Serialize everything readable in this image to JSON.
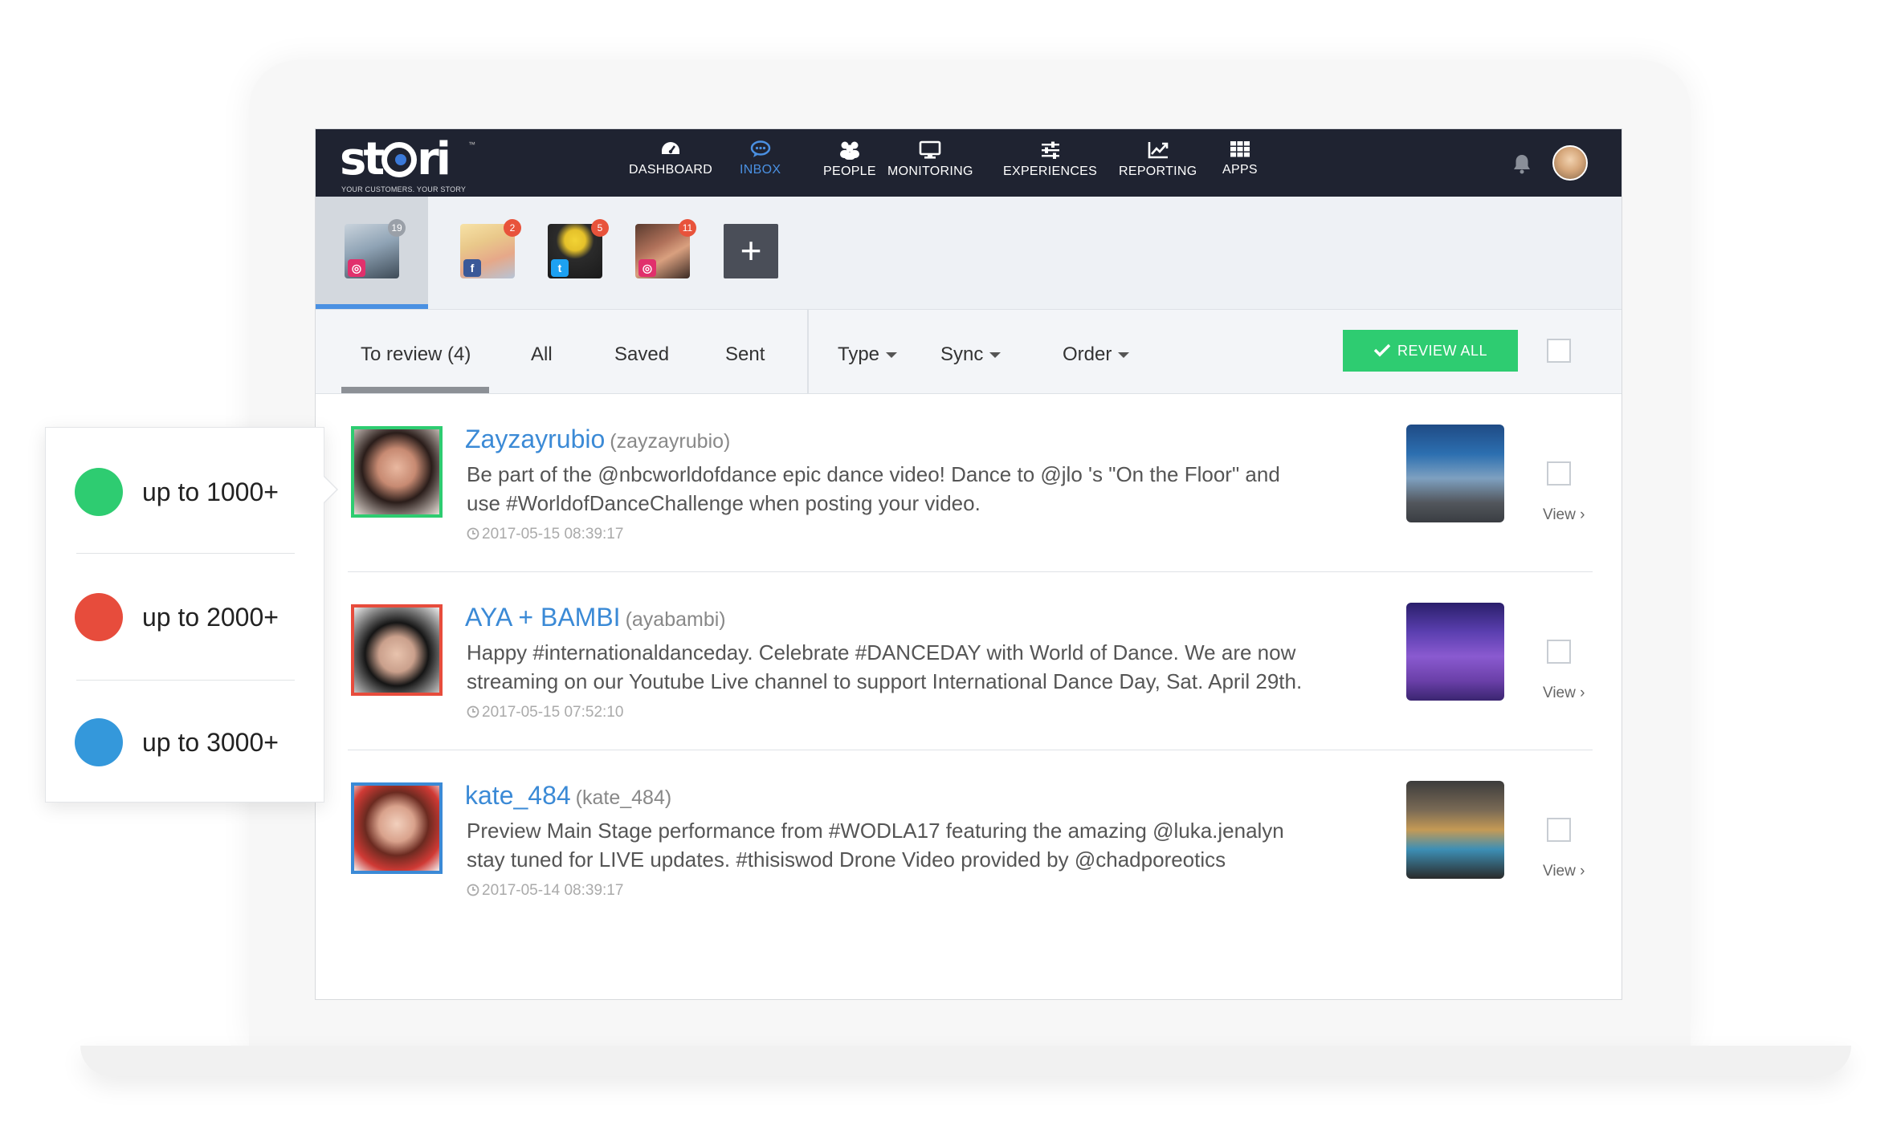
{
  "app": {
    "logo_text": "stori",
    "logo_tagline": "YOUR CUSTOMERS. YOUR STORY",
    "logo_tm": "™"
  },
  "nav": {
    "items": [
      {
        "label": "DASHBOARD",
        "icon": "dashboard-icon"
      },
      {
        "label": "INBOX",
        "icon": "chat-bubble-icon",
        "active": true
      },
      {
        "label": "PEOPLE",
        "icon": "people-icon"
      },
      {
        "label": "MONITORING",
        "icon": "monitor-icon"
      },
      {
        "label": "EXPERIENCES",
        "icon": "sliders-icon"
      },
      {
        "label": "REPORTING",
        "icon": "chart-line-icon"
      },
      {
        "label": "APPS",
        "icon": "grid-icon"
      }
    ],
    "accent_color": "#4a90e2"
  },
  "accounts": [
    {
      "network": "instagram",
      "network_glyph": "◎",
      "badge": "19"
    },
    {
      "network": "facebook",
      "network_glyph": "f",
      "badge": "2"
    },
    {
      "network": "twitter",
      "network_glyph": "t",
      "badge": "5"
    },
    {
      "network": "instagram",
      "network_glyph": "◎",
      "badge": "11"
    }
  ],
  "add_account_label": "+",
  "filters": {
    "tabs": [
      "To review (4)",
      "All",
      "Saved",
      "Sent"
    ],
    "active_tab": "To review (4)",
    "dropdowns": [
      "Type",
      "Sync",
      "Order"
    ],
    "review_all_label": "REVIEW ALL",
    "review_all_color": "#2ecc71"
  },
  "posts": [
    {
      "name": "Zayzayrubio",
      "handle": "(zayzayrubio)",
      "text": "Be part of the @nbcworldofdance epic dance video! Dance to @jlo 's \"On the Floor\" and use #WorldofDanceChallenge when posting your video.",
      "time": "2017-05-15 08:39:17",
      "border_color": "#2ecc71",
      "view_label": "View"
    },
    {
      "name": "AYA + BAMBI",
      "handle": "(ayabambi)",
      "text": "Happy #internationaldanceday. Celebrate #DANCEDAY with World of Dance. We are now streaming on our Youtube Live channel to support International Dance Day, Sat. April 29th.",
      "time": "2017-05-15 07:52:10",
      "border_color": "#e74c3c",
      "view_label": "View"
    },
    {
      "name": "kate_484",
      "handle": "(kate_484)",
      "text": "Preview Main Stage performance from #WODLA17 featuring the amazing @luka.jenalyn stay tuned for LIVE updates. #thisiswod Drone Video provided by @chadporeotics",
      "time": "2017-05-14 08:39:17",
      "border_color": "#3b8ad6",
      "view_label": "View"
    }
  ],
  "legend": [
    {
      "label": "up to  1000+",
      "color": "#2ecc71"
    },
    {
      "label": "up to  2000+",
      "color": "#e74c3c"
    },
    {
      "label": "up to  3000+",
      "color": "#3498db"
    }
  ]
}
